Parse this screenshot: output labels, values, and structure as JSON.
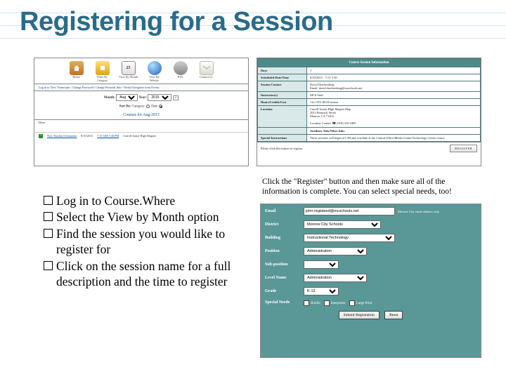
{
  "title": "Registering for a Session",
  "coursewhere": {
    "toolbar": [
      {
        "name": "home-icon",
        "label": "Home"
      },
      {
        "name": "filter-icon",
        "label": "Filter By Category"
      },
      {
        "name": "calendar-icon",
        "label": "View By Month"
      },
      {
        "name": "globe-icon",
        "label": "View By Website"
      },
      {
        "name": "wrench-icon",
        "label": "RIA"
      },
      {
        "name": "mail-icon",
        "label": "Contact Us"
      }
    ],
    "bar_text": "Log in to View Transcripts / Change Password / Change Personal Info / Verify/Unregister from Events",
    "month_label": "Month:",
    "month_value": "Aug",
    "year_label": "Year:",
    "year_value": "2015",
    "go": "»",
    "sort_label": "Sort By:",
    "sort_opt1": "Category",
    "sort_opt2": "Date",
    "heading": "Courses for Aug-2015",
    "other_label": "Other",
    "row_link": "New Teacher Orientation",
    "row_date": "8/10/2015",
    "row_time": "7:15 AM-3:30 PM",
    "row_loc": "Carroll Junior High Magnet"
  },
  "session_info": {
    "header": "Course Session Information",
    "rows": [
      {
        "label": "Days",
        "value": "1"
      },
      {
        "label": "Scheduled Date/Time",
        "value": "8/10/2015 - 7:15-3:30"
      },
      {
        "label": "Session Contact",
        "value": "David Drachenberg\nEmail: david.drachenberg@mcschools.net"
      },
      {
        "label": "Instructor(s)",
        "value": "MCS Staff"
      },
      {
        "label": "Hours/Credits/Cost",
        "value": "1 hr CEU $0.00 tuition"
      },
      {
        "label": "Location",
        "value": "Carroll Junior High Magnet  Map\n2913 Renwick Street\nMonroe, LA  71202\n\nLocation Contact   ☎ (318) 323-3483"
      },
      {
        "label": "",
        "value": "Auxiliary Aids/Other Info:"
      },
      {
        "label": "Special Instructions",
        "value": "These sessions will begin at CJH and conclude at the Central Office/Media Center/Technology Center rooms."
      }
    ],
    "reg_text": "Please click this button to register.",
    "reg_button": "REGISTER"
  },
  "bullets": [
    "Log in to Course.Where",
    "Select the View by Month option",
    "Find the session you would like to register for",
    "Click on the session name for a full description and the time to register"
  ],
  "caption": "Click the \"Register\" button and then make sure all of the information is complete.  You can select special needs, too!",
  "form": {
    "email_label": "Email",
    "email_value": "john.registeed@mcschools.net",
    "email_hint": "Monroe City email address only",
    "district_label": "District",
    "district_value": "Monroe City Schools",
    "building_label": "Building",
    "building_value": "Instructional Technology",
    "position_label": "Position",
    "position_value": "Administration",
    "subposition_label": "Sub-position",
    "subposition_value": "",
    "level_label": "Level Name",
    "level_value": "Administration",
    "grade_label": "Grade",
    "grade_value": "K-12",
    "special_label": "Special Needs",
    "sn1": "Braille",
    "sn2": "Interpreter",
    "sn3": "Large Print",
    "submit": "Submit Registration",
    "reset": "Reset"
  }
}
